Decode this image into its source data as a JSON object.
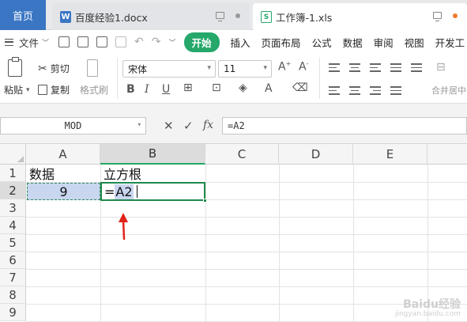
{
  "tabs": {
    "home": "首页",
    "docx": "百度经验1.docx",
    "xls": "工作簿-1.xls"
  },
  "menu": {
    "file": "文件",
    "items": [
      "开始",
      "插入",
      "页面布局",
      "公式",
      "数据",
      "审阅",
      "视图",
      "开发工"
    ]
  },
  "ribbon": {
    "paste": "粘贴",
    "cut": "剪切",
    "copy": "复制",
    "format_painter": "格式刷",
    "font_name": "宋体",
    "font_size": "11",
    "merge": "合并居中"
  },
  "formula_bar": {
    "name_box": "MOD",
    "cancel": "✕",
    "confirm": "✓",
    "fx": "fx",
    "formula": "=A2"
  },
  "grid": {
    "columns": [
      "A",
      "B",
      "C",
      "D",
      "E"
    ],
    "rows": [
      "1",
      "2",
      "3",
      "4",
      "5",
      "6",
      "7",
      "8",
      "9"
    ],
    "selected_column": "B",
    "selected_row": "2",
    "cells": {
      "A1": "数据",
      "B1": "立方根",
      "A2": "9",
      "B2_prefix": "=",
      "B2_ref": "A2"
    }
  },
  "watermark": {
    "title": "Baidu经验",
    "url": "jingyan.baidu.com"
  },
  "colors": {
    "accent_green": "#25a86a",
    "home_tab_blue": "#3a76c4",
    "ref_highlight": "#c9d6f0",
    "annotation_red": "#e0221a"
  }
}
